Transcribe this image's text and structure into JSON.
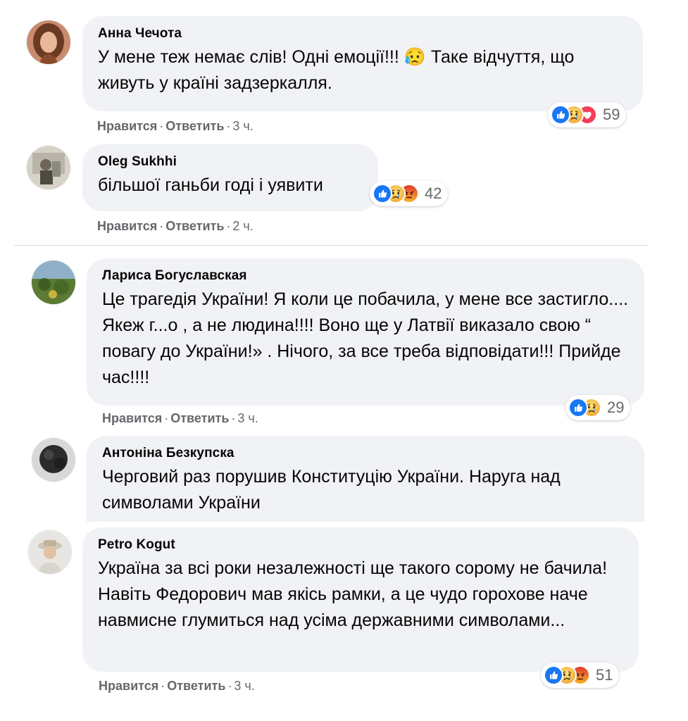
{
  "comments": [
    {
      "author": "Анна Чечота",
      "text": "У мене теж немає слів! Одні емоції!!! 😥 Таке відчуття, що живуть у країні задзеркалля.",
      "actions": {
        "like": "Нравится",
        "reply": "Ответить",
        "time": "3 ч."
      },
      "reactions": {
        "icons": [
          "like-icon",
          "sad-icon",
          "love-icon"
        ],
        "count": "59"
      }
    },
    {
      "author": "Oleg Sukhhi",
      "text": "більшої ганьби годі і уявити",
      "actions": {
        "like": "Нравится",
        "reply": "Ответить",
        "time": "2 ч."
      },
      "reactions": {
        "icons": [
          "like-icon",
          "sad-icon",
          "angry-icon"
        ],
        "count": "42"
      }
    },
    {
      "author": "Лариса Богуславская",
      "text": "Це трагедія України! Я коли це побачила, у мене все застигло.... Якеж г...о , а не людина!!!! Воно ще у Латвії виказало свою “ повагу до України!» . Нічого, за все треба відповідати!!! Прийде час!!!!",
      "actions": {
        "like": "Нравится",
        "reply": "Ответить",
        "time": "3 ч."
      },
      "reactions": {
        "icons": [
          "like-icon",
          "sad-icon"
        ],
        "count": "29"
      }
    },
    {
      "author": "Антоніна Безкупска",
      "text": "Черговий раз порушив Конституцію України. Наруга над символами України"
    },
    {
      "author": "Petro Kogut",
      "text": "Україна за всі роки незалежності ще такого сорому не бачила! Навіть Федорович мав якісь рамки, а це чудо горохове наче навмисне глумиться над усіма державними символами...",
      "actions": {
        "like": "Нравится",
        "reply": "Ответить",
        "time": "3 ч."
      },
      "reactions": {
        "icons": [
          "like-icon",
          "sad-icon",
          "angry-icon"
        ],
        "count": "51"
      }
    }
  ],
  "colors": {
    "bubble": "#f0f2f5",
    "like": "#1877f2",
    "love": "#f33e58",
    "sad": "#f7b928",
    "angry": "#e9710f",
    "meta_text": "#65676b"
  }
}
